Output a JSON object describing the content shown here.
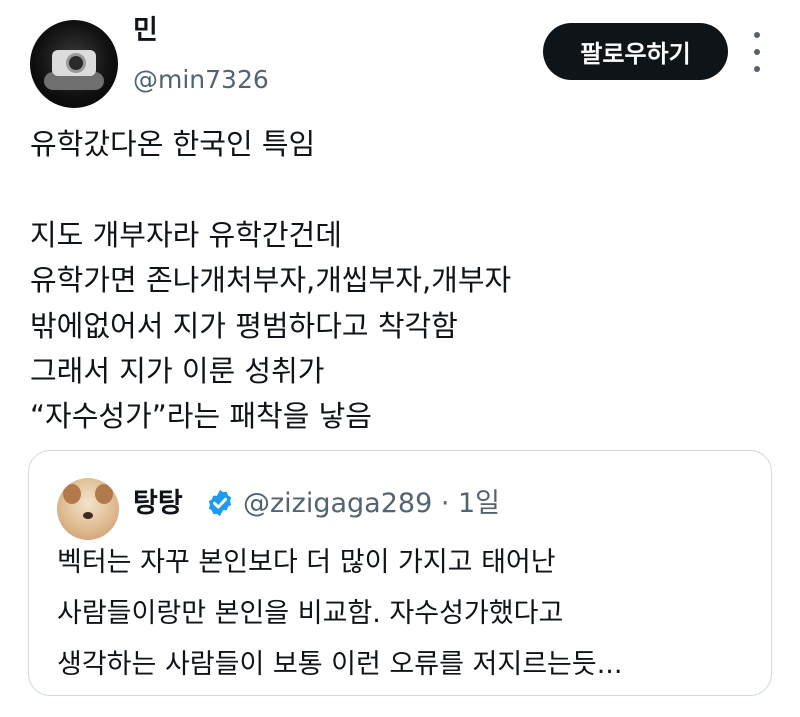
{
  "author": {
    "name": "민",
    "handle": "@min7326",
    "follow_label": "팔로우하기"
  },
  "tweet": {
    "text": "유학갔다온 한국인 특임\n\n지도 개부자라 유학간건데\n유학가면 존나개처부자,개씹부자,개부자\n밖에없어서 지가 평범하다고 착각함\n그래서 지가 이룬 성취가\n“자수성가”라는 패착을 낳음"
  },
  "quoted": {
    "name": "탕탕",
    "handle_time": "@zizigaga289 · 1일",
    "text": "벡터는 자꾸 본인보다 더 많이 가지고 태어난\n사람들이랑만 본인을 비교함. 자수성가했다고\n생각하는 사람들이 보통 이런 오류를 저지르는듯..."
  },
  "icons": {
    "more": "more-vertical-icon",
    "verified": "verified-badge-icon"
  },
  "colors": {
    "button_bg": "#0f1419",
    "secondary_text": "#536471",
    "verified_blue": "#1d9bf0",
    "quote_border": "#cfd9de"
  }
}
